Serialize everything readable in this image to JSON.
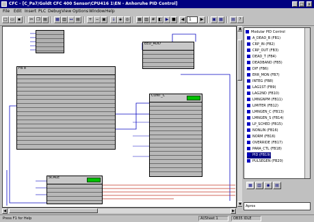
{
  "window": {
    "title": "CFC - [C_Pa7/Goldt CFC 400 Sensor\\CPU416 1\\EN - Anhoruhe PID Control]",
    "minimize_label": "_",
    "maximize_label": "□",
    "close_label": "x"
  },
  "menu": [
    "File",
    "Edit",
    "Insert",
    "PLC",
    "Debug",
    "View",
    "Options",
    "Window",
    "Help"
  ],
  "toolbar": {
    "page_field": "1"
  },
  "colors": {
    "title_bar": "#000080",
    "wire_red": "#c03020",
    "wire_blue": "#0000c0",
    "block_green": "#00c000",
    "selection": "#000080"
  },
  "blocks": [
    {
      "name": "block-top-center",
      "title": "EED_ADD"
    },
    {
      "name": "block-left",
      "title": "FB 8"
    },
    {
      "name": "block-center",
      "title": "CONT_C"
    },
    {
      "name": "block-bottom",
      "title": "SCALE"
    }
  ],
  "catalog": {
    "items": [
      "Modular PID Control",
      "A_DEAD_B (FB1)",
      "CRP_IN (FB2)",
      "CRP_OUT (FB3)",
      "DEAD_T (FB4)",
      "DEADBAND (FB5)",
      "DIF (FB6)",
      "ERR_MON (FB7)",
      "INTEG (FB8)",
      "LAG1ST (FB9)",
      "LAG2ND (FB10)",
      "LMNGNPM (FB11)",
      "LIMITER (FB12)",
      "LMNGEN_C (FB13)",
      "LMNGEN_S (FB14)",
      "LP_SCHED (FB15)",
      "NONLIN (FB16)",
      "NORM (FB16)",
      "OVERRIDE (FB17)",
      "PARA_CTL (FB18)",
      "PID (FB19)",
      "PULSEGEN (FB20)"
    ],
    "search_value": "Apros"
  },
  "status": {
    "help_text": "Press F1 for Help",
    "sheet": "Al/Sheet 1",
    "mode": "OB35 IDLE"
  }
}
